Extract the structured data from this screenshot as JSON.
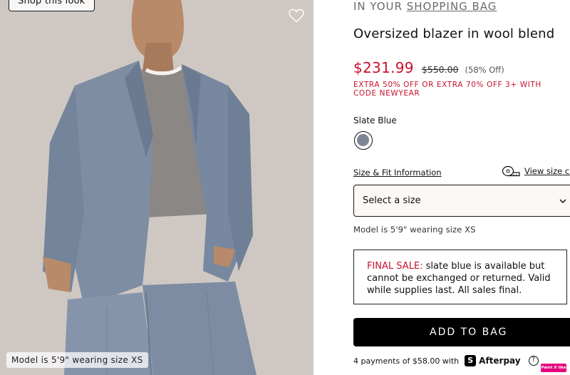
{
  "image": {
    "shop_button": "Shop this look",
    "model_caption": "Model is 5'9\" wearing size XS",
    "background_color": "#cbc3bd",
    "suit_color": "#7e8da2"
  },
  "bag_note": {
    "prefix": "IN YOUR ",
    "link": "SHOPPING BAG"
  },
  "product": {
    "title": "Oversized blazer in wool blend",
    "price_sale": "$231.99",
    "price_original": "$550.00",
    "discount": "(58% Off)",
    "promo": "EXTRA 50% OFF OR EXTRA 70% OFF 3+ WITH CODE NEWYEAR",
    "sale_color": "#c8102e"
  },
  "color": {
    "name": "Slate Blue",
    "swatch_hex": "#7b8595"
  },
  "size": {
    "info_link": "Size & Fit Information",
    "chart_link": "View size chart",
    "select_placeholder": "Select a size",
    "model_note": "Model is 5'9\" wearing size XS"
  },
  "final_sale": {
    "label": "FINAL SALE:",
    "text": " slate blue is available but cannot be exchanged or returned. Valid while supplies last. All sales final."
  },
  "cta": {
    "add_to_bag": "ADD TO BAG"
  },
  "afterpay": {
    "text": "4 payments of $58.00 with",
    "icon": "S",
    "brand": "Afterpay",
    "help": "?"
  },
  "badge": {
    "label": "Paint X like"
  }
}
